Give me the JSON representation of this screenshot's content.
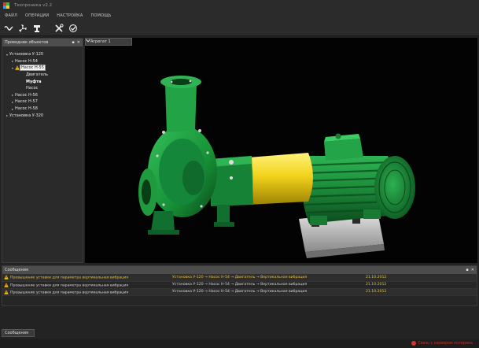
{
  "app": {
    "title": "Техпроника v2.2"
  },
  "menu": {
    "items": [
      "ФАЙЛ",
      "ОПЕРАЦИИ",
      "НАСТРОЙКА",
      "ПОМОЩЬ"
    ]
  },
  "explorer": {
    "title": "Проводник объектов",
    "controls": [
      "▪",
      "✕"
    ],
    "tree": [
      {
        "label": "Установка У-120",
        "level": 0,
        "expander": "▾"
      },
      {
        "label": "Насос Н-54",
        "level": 1,
        "expander": "▸"
      },
      {
        "label": "Насос Н-55",
        "level": 1,
        "expander": "▾",
        "selected": true,
        "warning": true
      },
      {
        "label": "Двигатель",
        "level": 2
      },
      {
        "label": "Муфта",
        "level": 2,
        "bold": true
      },
      {
        "label": "Насос",
        "level": 2
      },
      {
        "label": "Насос Н-56",
        "level": 1,
        "expander": "▸"
      },
      {
        "label": "Насос Н-57",
        "level": 1,
        "expander": "▸"
      },
      {
        "label": "Насос Н-58",
        "level": 1,
        "expander": "▸"
      },
      {
        "label": "Установка У-320",
        "level": 0,
        "expander": "▸"
      }
    ]
  },
  "viewport": {
    "tab_label": "Агрегат 1"
  },
  "messages": {
    "rows": [
      {
        "desc": "Превышение уставки для параметра вертикальная вибрация",
        "path": "Установка У-120 → Насос Н-54 → Двигатель → Вертикальная вибрация",
        "date": "21.10.2012",
        "highlight": true
      },
      {
        "desc": "Превышение уставки для параметра вертикальная вибрация",
        "path": "Установка У-120 → Насос Н-54 → Двигатель → Вертикальная вибрация",
        "date": "21.10.2012",
        "highlight": false
      },
      {
        "desc": "Превышение уставки для параметра вертикальная вибрация",
        "path": "Установка У-120 → Насос Н-54 → Двигатель → Вертикальная вибрация",
        "date": "21.10.2012",
        "highlight": false
      }
    ]
  },
  "bottom_tab": {
    "label": "Сообщения"
  },
  "status": {
    "text": "Связь с сервером потеряна"
  },
  "colors": {
    "pump_green": "#1f9a3c",
    "coupling_yellow": "#f2d21a",
    "warning": "#f2c200",
    "accent_red": "#d8332a"
  }
}
